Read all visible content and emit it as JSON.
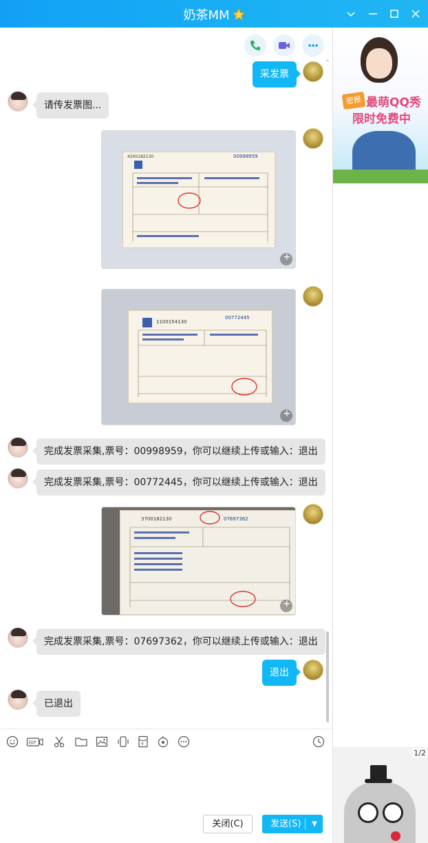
{
  "window": {
    "title": "奶茶MM"
  },
  "messages": {
    "m1": "采发票",
    "m2": "请传发票图...",
    "m3": "完成发票采集,票号：00998959，你可以继续上传或输入：退出",
    "m4": "完成发票采集,票号：00772445，你可以继续上传或输入：退出",
    "m5": "完成发票采集,票号：07697362，你可以继续上传或输入：退出",
    "m6": "退出",
    "m7": "已退出"
  },
  "invoices": {
    "i1": {
      "code": "4200182130",
      "number": "00998959"
    },
    "i2": {
      "code": "1100154130",
      "number": "00772445"
    },
    "i3": {
      "code": "3700182130",
      "number": "07697362"
    }
  },
  "buttons": {
    "close": "关闭(C)",
    "send": "发送(S)"
  },
  "ad": {
    "tag": "密报",
    "line1": "最萌QQ秀",
    "line2": "限时免费中"
  },
  "sticker": {
    "page": "1/2"
  },
  "colors": {
    "accent": "#12b7f5",
    "titlebar": "#1ab0f4",
    "bubble_in": "#e6e6e6"
  },
  "icons": {
    "phone": "phone-icon",
    "video": "video-icon",
    "more": "more-icon"
  }
}
